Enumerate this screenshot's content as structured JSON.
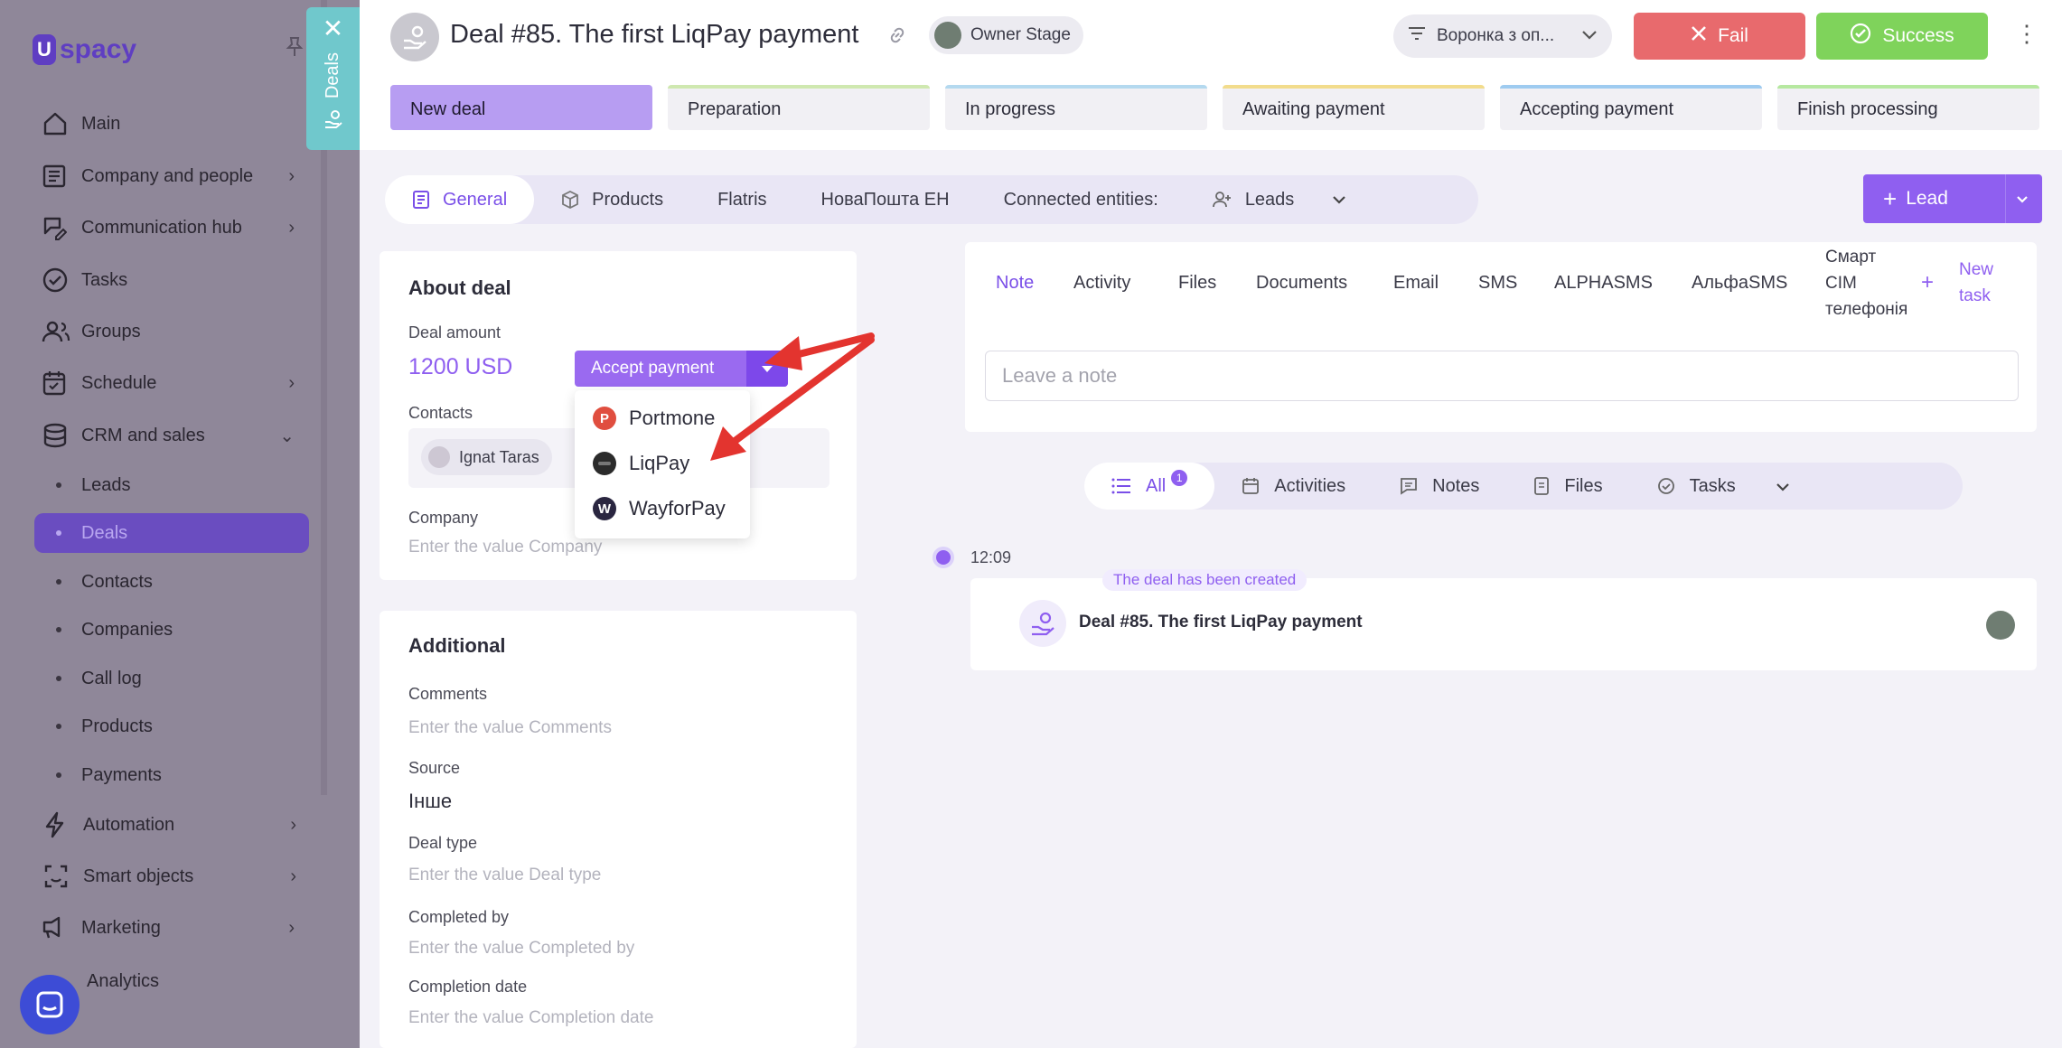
{
  "sidebar": {
    "logo": "spacy",
    "items": [
      {
        "label": "Main",
        "icon": "home-icon"
      },
      {
        "label": "Company and people",
        "icon": "company-icon"
      },
      {
        "label": "Communication hub",
        "icon": "chat-edit-icon"
      },
      {
        "label": "Tasks",
        "icon": "check-circle-icon"
      },
      {
        "label": "Groups",
        "icon": "users-icon"
      },
      {
        "label": "Schedule",
        "icon": "calendar-icon"
      },
      {
        "label": "CRM and sales",
        "icon": "database-icon"
      },
      {
        "label": "Automation",
        "icon": "lightning-icon"
      },
      {
        "label": "Smart objects",
        "icon": "smart-object-icon"
      },
      {
        "label": "Marketing",
        "icon": "marketing-icon"
      },
      {
        "label": "Analytics",
        "icon": "analytics-icon"
      }
    ],
    "crm_sub": [
      "Leads",
      "Deals",
      "Contacts",
      "Companies",
      "Call log",
      "Products",
      "Payments"
    ],
    "active_sub": "Deals"
  },
  "deals_tab": {
    "label": "Deals"
  },
  "header": {
    "title": "Deal #85. The first LiqPay payment",
    "owner_stage": "Owner Stage",
    "funnel": "Воронка з оп...",
    "fail_label": "Fail",
    "success_label": "Success"
  },
  "stages": [
    {
      "label": "New deal",
      "color": "#b79df2"
    },
    {
      "label": "Preparation",
      "color": "#cfe8b0"
    },
    {
      "label": "In progress",
      "color": "#b4d9ef"
    },
    {
      "label": "Awaiting payment",
      "color": "#f2dc8c"
    },
    {
      "label": "Accepting payment",
      "color": "#9ecbf0"
    },
    {
      "label": "Finish processing",
      "color": "#b6e8a0"
    }
  ],
  "tabs": {
    "general": "General",
    "products": "Products",
    "flatris": "Flatris",
    "novaposhta": "НоваПошта ЕН",
    "connected": "Connected entities:",
    "leads": "Leads"
  },
  "lead_button": "Lead",
  "about": {
    "title": "About deal",
    "deal_amount_label": "Deal amount",
    "deal_amount": "1200 USD",
    "accept_payment": "Accept payment",
    "contacts_label": "Contacts",
    "contact_name": "Ignat Taras",
    "company_label": "Company",
    "company_placeholder": "Enter the value Company"
  },
  "payment_menu": {
    "items": [
      {
        "label": "Portmone",
        "color": "#e04e3f",
        "letter": "P"
      },
      {
        "label": "LiqPay",
        "color": "#2b2b2b",
        "letter": ""
      },
      {
        "label": "WayforPay",
        "color": "#2a2640",
        "letter": "W"
      }
    ]
  },
  "additional": {
    "title": "Additional",
    "comments_label": "Comments",
    "comments_placeholder": "Enter the value Comments",
    "source_label": "Source",
    "source_value": "Інше",
    "deal_type_label": "Deal type",
    "deal_type_placeholder": "Enter the value Deal type",
    "completed_by_label": "Completed by",
    "completed_by_placeholder": "Enter the value Completed by",
    "completion_date_label": "Completion date",
    "completion_date_placeholder": "Enter the value Completion date"
  },
  "activity_tabs": {
    "note": "Note",
    "activity": "Activity",
    "files": "Files",
    "documents": "Documents",
    "email": "Email",
    "sms": "SMS",
    "alphasms": "ALPHASMS",
    "alfasms": "АльфаSMS",
    "smart_line1": "Смарт",
    "smart_line2": "СІМ",
    "smart_line3": "телефонія",
    "new_task_line1": "New",
    "new_task_line2": "task"
  },
  "note_placeholder": "Leave a note",
  "filters": {
    "all": "All",
    "all_badge": "1",
    "activities": "Activities",
    "notes": "Notes",
    "files": "Files",
    "tasks": "Tasks"
  },
  "timeline": {
    "time": "12:09",
    "event_label": "The deal has been created",
    "event_title": "Deal #85. The first LiqPay payment"
  },
  "colors": {
    "accent": "#8f5ff0",
    "fail": "#e86a6d",
    "success": "#7fd35b",
    "annotation_arrow": "#e3342f"
  }
}
